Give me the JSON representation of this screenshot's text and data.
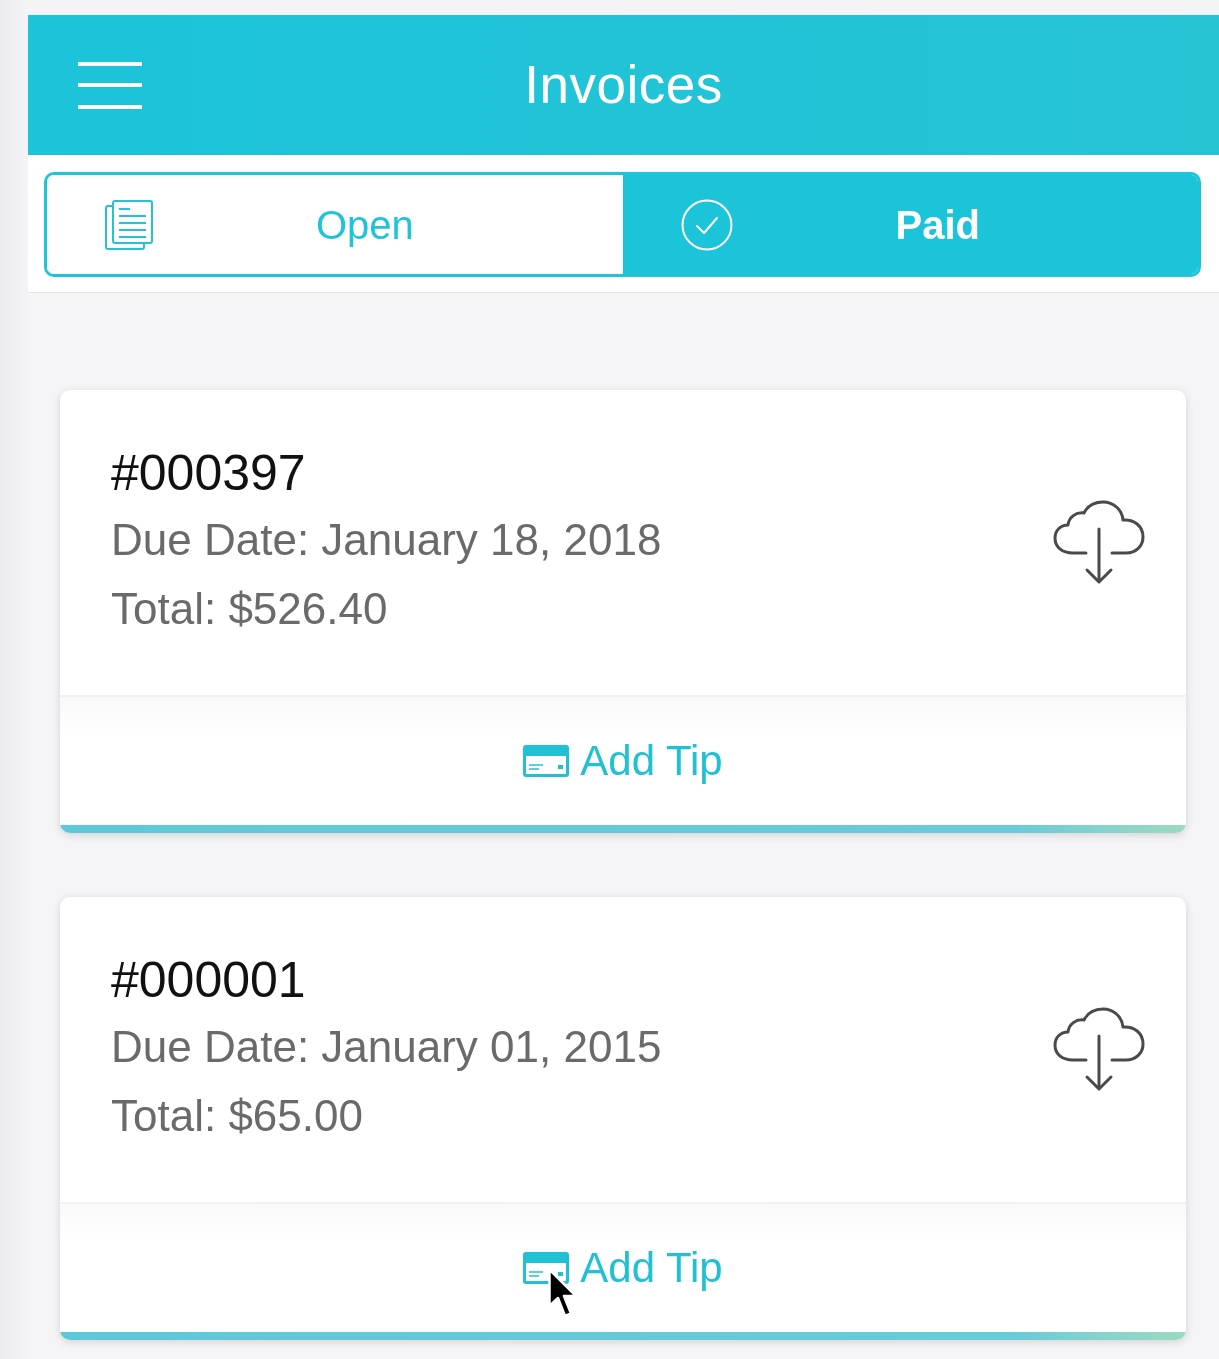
{
  "header": {
    "title": "Invoices"
  },
  "tabs": [
    {
      "label": "Open",
      "kind": "open",
      "selected": false
    },
    {
      "label": "Paid",
      "kind": "paid",
      "selected": true
    }
  ],
  "invoices": [
    {
      "number": "#000397",
      "due_date": "Due Date: January 18, 2018",
      "total": "Total: $526.40",
      "action": "Add Tip",
      "pointer_over": false
    },
    {
      "number": "#000001",
      "due_date": "Due Date: January 01, 2015",
      "total": "Total: $65.00",
      "action": "Add Tip",
      "pointer_over": true
    }
  ]
}
